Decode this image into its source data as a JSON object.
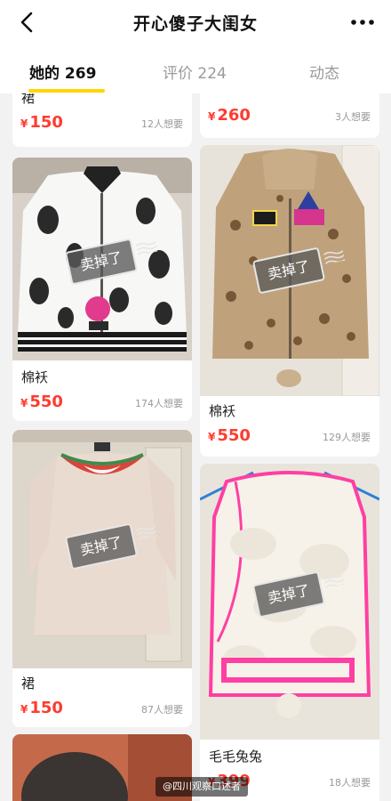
{
  "header": {
    "title": "开心傻子大闺女",
    "back_icon": "chevron-left-icon",
    "more_icon": "more-dots-icon"
  },
  "tabs": [
    {
      "label": "她的 269",
      "active": true
    },
    {
      "label": "评价 224",
      "active": false
    },
    {
      "label": "动态",
      "active": false
    }
  ],
  "sold_label": "卖掉了",
  "items": [
    {
      "id": "l0",
      "name": "裙",
      "price_symbol": "¥",
      "price": "150",
      "wants": "12人想要"
    },
    {
      "id": "l1",
      "name": "棉袄",
      "price_symbol": "¥",
      "price": "550",
      "wants": "174人想要",
      "sold": true
    },
    {
      "id": "l2",
      "name": "裙",
      "price_symbol": "¥",
      "price": "150",
      "wants": "87人想要",
      "sold": true
    },
    {
      "id": "r0",
      "name": "",
      "price_symbol": "¥",
      "price": "260",
      "wants": "3人想要"
    },
    {
      "id": "r1",
      "name": "棉袄",
      "price_symbol": "¥",
      "price": "550",
      "wants": "129人想要",
      "sold": true
    },
    {
      "id": "r2",
      "name": "毛毛兔兔",
      "price_symbol": "¥",
      "price": "399",
      "wants": "18人想要",
      "sold": true
    }
  ],
  "watermark": "@四川观察口述者"
}
